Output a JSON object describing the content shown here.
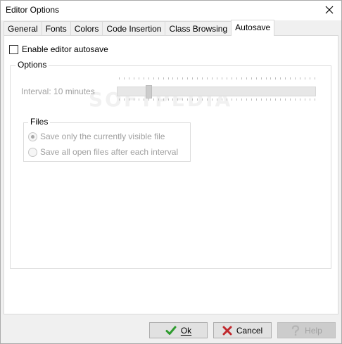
{
  "window": {
    "title": "Editor Options"
  },
  "tabs": [
    {
      "label": "General"
    },
    {
      "label": "Fonts"
    },
    {
      "label": "Colors"
    },
    {
      "label": "Code Insertion"
    },
    {
      "label": "Class Browsing"
    },
    {
      "label": "Autosave",
      "active": true
    }
  ],
  "autosave": {
    "enable_label": "Enable editor autosave",
    "enabled": false,
    "options_title": "Options",
    "interval_label": "Interval: 10 minutes",
    "interval_minutes": 10,
    "files_title": "Files",
    "radio_visible_label": "Save only the currently visible file",
    "radio_all_label": "Save all open files after each interval",
    "selected_radio": "visible"
  },
  "buttons": {
    "ok_label": "Ok",
    "cancel_label": "Cancel",
    "help_label": "Help"
  },
  "watermark": "SOFTPEDIA",
  "colors": {
    "ok_check": "#2e9b2e",
    "cancel_x": "#c0282d",
    "disabled_text": "#a0a0a0"
  },
  "icons": {
    "close": "close-icon",
    "ok": "checkmark-icon",
    "cancel": "x-icon",
    "help": "question-icon"
  }
}
